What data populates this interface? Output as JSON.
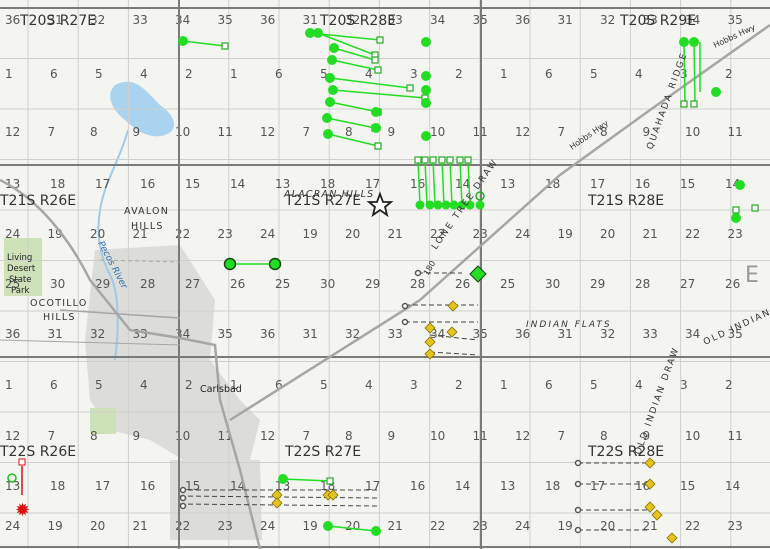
{
  "map": {
    "colors": {
      "background": "#f4f4f1",
      "grid": "#c9c9c9",
      "township_line": "#7a7a7a",
      "water": "#a9d3ee",
      "park": "#c9dfb2",
      "urban": "#d9d9d6",
      "well_green": "#22dd22",
      "well_yellow": "#e3c320",
      "well_red": "#dd1111",
      "road": "#9a9a9a"
    },
    "township_labels": [
      {
        "id": "t20s-r27e",
        "text": "T20S R27E"
      },
      {
        "id": "t20s-r28e",
        "text": "T20S R28E"
      },
      {
        "id": "t20s-r29e",
        "text": "T20S R29E"
      },
      {
        "id": "t21s-r26e",
        "text": "T21S R26E"
      },
      {
        "id": "t21s-r27e",
        "text": "T21S R27E"
      },
      {
        "id": "t21s-r28e",
        "text": "T21S R28E"
      },
      {
        "id": "t22s-r26e",
        "text": "T22S R26E"
      },
      {
        "id": "t22s-r27e",
        "text": "T22S R27E"
      },
      {
        "id": "t22s-r28e",
        "text": "T22S R28E"
      }
    ],
    "place_labels": {
      "avalon_hills_1": "AVALON",
      "avalon_hills_2": "HILLS",
      "alacran_hills": "ALACRAN HILLS",
      "ocotillo_1": "OCOTILLO",
      "ocotillo_2": "HILLS",
      "indian_flats": "INDIAN FLATS",
      "lone_tree_draw": "LONE TREE DRAW",
      "old_indian_draw": "OLD INDIAN DRAW",
      "old_indian_right": "OLD INDIAN",
      "quahada_ridge": "QUAHADA RIDGE",
      "hobbs_hwy_1": "Hobbs Hwy",
      "hobbs_hwy_2": "Hobbs Hwy",
      "route_180": "180",
      "pecos_river": "Pecos River",
      "park_1": "Living",
      "park_2": "Desert",
      "park_3": "State",
      "park_4": "Park",
      "carlsbad": "Carlsbad",
      "edge_letter": "E"
    },
    "sections": [
      "36",
      "31",
      "32",
      "33",
      "34",
      "35",
      "36",
      "31",
      "32",
      "33",
      "34",
      "35",
      "36",
      "31",
      "32",
      "33",
      "34",
      "35",
      "1",
      "6",
      "5",
      "4",
      "2",
      "1",
      "6",
      "5",
      "4",
      "3",
      "2",
      "1",
      "6",
      "5",
      "4",
      "3",
      "2",
      "12",
      "7",
      "8",
      "9",
      "10",
      "11",
      "12",
      "7",
      "8",
      "9",
      "10",
      "11",
      "12",
      "7",
      "8",
      "9",
      "10",
      "11",
      "13",
      "18",
      "17",
      "16",
      "15",
      "14",
      "13",
      "18",
      "17",
      "16",
      "14",
      "13",
      "18",
      "17",
      "16",
      "15",
      "14",
      "24",
      "19",
      "20",
      "21",
      "22",
      "23",
      "24",
      "19",
      "20",
      "21",
      "22",
      "23",
      "24",
      "19",
      "20",
      "21",
      "22",
      "23",
      "25",
      "30",
      "29",
      "28",
      "27",
      "26",
      "25",
      "30",
      "29",
      "28",
      "26",
      "25",
      "30",
      "29",
      "28",
      "27",
      "26",
      "36",
      "31",
      "32",
      "33",
      "34",
      "35",
      "36",
      "31",
      "32",
      "33",
      "34",
      "35",
      "36",
      "31",
      "32",
      "33",
      "34",
      "35",
      "1",
      "6",
      "5",
      "4",
      "2",
      "1",
      "6",
      "5",
      "4",
      "3",
      "2",
      "1",
      "6",
      "5",
      "4",
      "3",
      "2",
      "12",
      "7",
      "8",
      "9",
      "10",
      "11",
      "12",
      "7",
      "8",
      "9",
      "10",
      "11",
      "12",
      "7",
      "8",
      "9",
      "10",
      "11",
      "13",
      "18",
      "17",
      "16",
      "15",
      "14",
      "13",
      "18",
      "17",
      "16",
      "14",
      "13",
      "18",
      "17",
      "16",
      "15",
      "14",
      "24",
      "19",
      "20",
      "21",
      "22",
      "23",
      "24",
      "19",
      "20",
      "21",
      "22",
      "23",
      "24",
      "19",
      "20",
      "21",
      "22",
      "23"
    ]
  }
}
